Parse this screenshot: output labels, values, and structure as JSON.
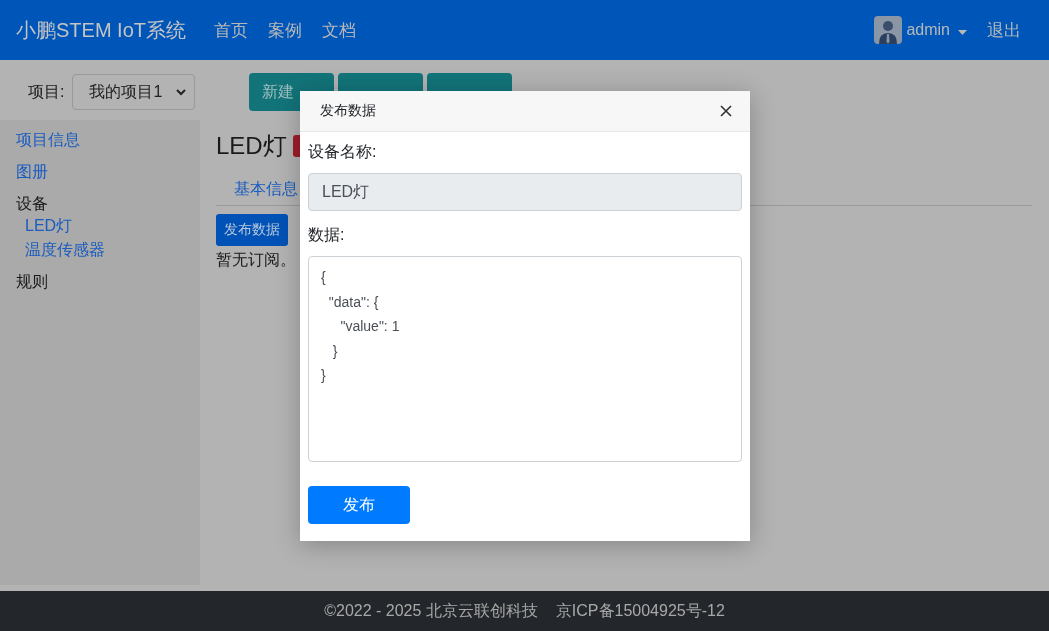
{
  "navbar": {
    "brand": "小鹏STEM IoT系统",
    "links": [
      "首页",
      "案例",
      "文档"
    ],
    "user": "admin",
    "logout": "退出"
  },
  "toolbar": {
    "project_label": "项目:",
    "project_value": "我的项目1",
    "buttons": [
      {
        "kind": "labelled",
        "label": "新建"
      },
      {
        "kind": "covered"
      },
      {
        "kind": "covered"
      }
    ]
  },
  "sidebar": {
    "items": [
      {
        "label": "项目信息",
        "kind": "link"
      },
      {
        "label": "图册",
        "kind": "link"
      },
      {
        "label": "设备",
        "kind": "heading",
        "children": [
          {
            "label": "LED灯",
            "kind": "link"
          },
          {
            "label": "温度传感器",
            "kind": "link"
          }
        ]
      },
      {
        "label": "规则",
        "kind": "heading"
      }
    ]
  },
  "main": {
    "title": "LED灯",
    "tabs": [
      {
        "label": "基本信息",
        "selected": false
      }
    ],
    "publish_button": "发布数据",
    "empty_text": "暂无订阅。"
  },
  "modal": {
    "title": "发布数据",
    "fields": [
      {
        "kind": "input",
        "label": "设备名称:",
        "value": "LED灯",
        "disabled": true
      },
      {
        "kind": "textarea",
        "label": "数据:",
        "value": "{\n  \"data\": {\n     \"value\": 1\n   }\n}"
      }
    ],
    "submit": "发布"
  },
  "footer": {
    "copyright": "©2022 - 2025 北京云联创科技",
    "icp": "京ICP备15004925号-12"
  }
}
